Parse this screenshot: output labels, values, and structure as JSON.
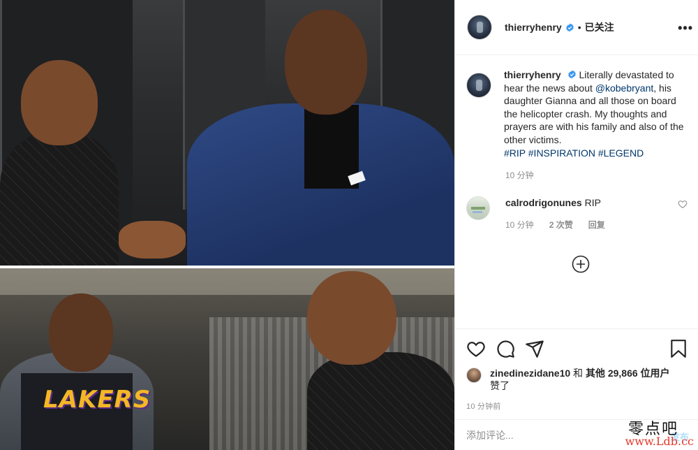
{
  "post": {
    "author": {
      "username": "thierryhenry",
      "verified": true,
      "follow_state": "已关注",
      "separator": "•"
    },
    "caption": {
      "username": "thierryhenry",
      "text_before": "Literally devastated to hear the news about ",
      "mention": "@kobebryant",
      "text_after": ", his daughter Gianna and all those on board the helicopter crash. My thoughts and prayers are with his family and also of the other victims.",
      "hashtags": [
        "#RIP",
        "#INSPIRATION",
        "#LEGEND"
      ],
      "time": "10 分钟"
    },
    "comments": [
      {
        "username": "calrodrigonunes",
        "text": "RIP",
        "time": "10 分钟",
        "likes": "2 次赞",
        "reply_label": "回复"
      }
    ],
    "likes": {
      "liked_by": "zinedinezidane10",
      "conjunction": " 和 ",
      "others": "其他 29,866 位用户",
      "suffix": "赞了"
    },
    "post_time": "10 分钟前",
    "add_comment": {
      "placeholder": "添加评论...",
      "post_label": "发布"
    },
    "photo_text": {
      "jersey": "LAKERS"
    }
  },
  "icons": {
    "more": "more-options-icon",
    "verified": "verified-badge-icon",
    "load_more": "add-circle-icon",
    "like": "heart-icon",
    "comment": "comment-icon",
    "share": "share-icon",
    "save": "bookmark-icon"
  },
  "colors": {
    "text": "#262626",
    "secondary": "#8e8e8e",
    "link": "#00376b",
    "verified": "#3897f0",
    "post_button": "#b2dffc"
  },
  "watermark": {
    "cn": "零点吧",
    "url": "www.Ldb.cc"
  }
}
